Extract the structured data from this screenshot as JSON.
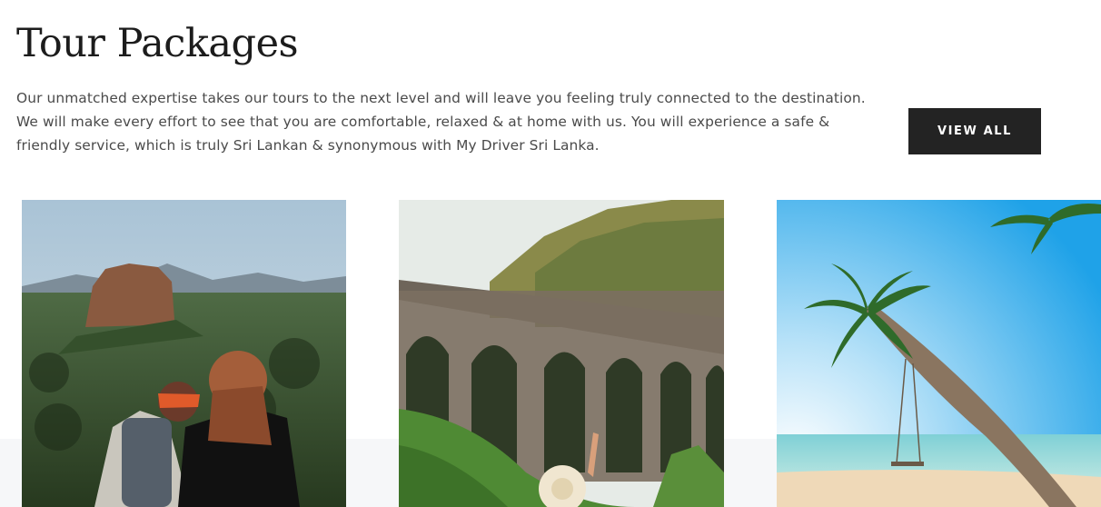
{
  "section": {
    "title": "Tour Packages",
    "description_lines": [
      "Our unmatched expertise takes our tours to the next level and will leave you feeling truly connected to the destination.",
      "We will make every effort to see that you are comfortable, relaxed & at home with us. You will experience a safe &",
      "friendly service, which is truly Sri Lankan & synonymous with My Driver Sri Lanka."
    ],
    "view_all_label": "VIEW ALL"
  },
  "cards": [
    {
      "image": "couple-overlooking-sigiriya-rock-photo"
    },
    {
      "image": "nine-arch-bridge-traveler-photo"
    },
    {
      "image": "palm-tree-swing-beach-photo"
    }
  ],
  "colors": {
    "button_bg": "#232323",
    "button_text": "#ffffff",
    "title_text": "#1c1c1c",
    "body_text": "#4a4a4a",
    "band_bg": "#f6f7f9"
  }
}
